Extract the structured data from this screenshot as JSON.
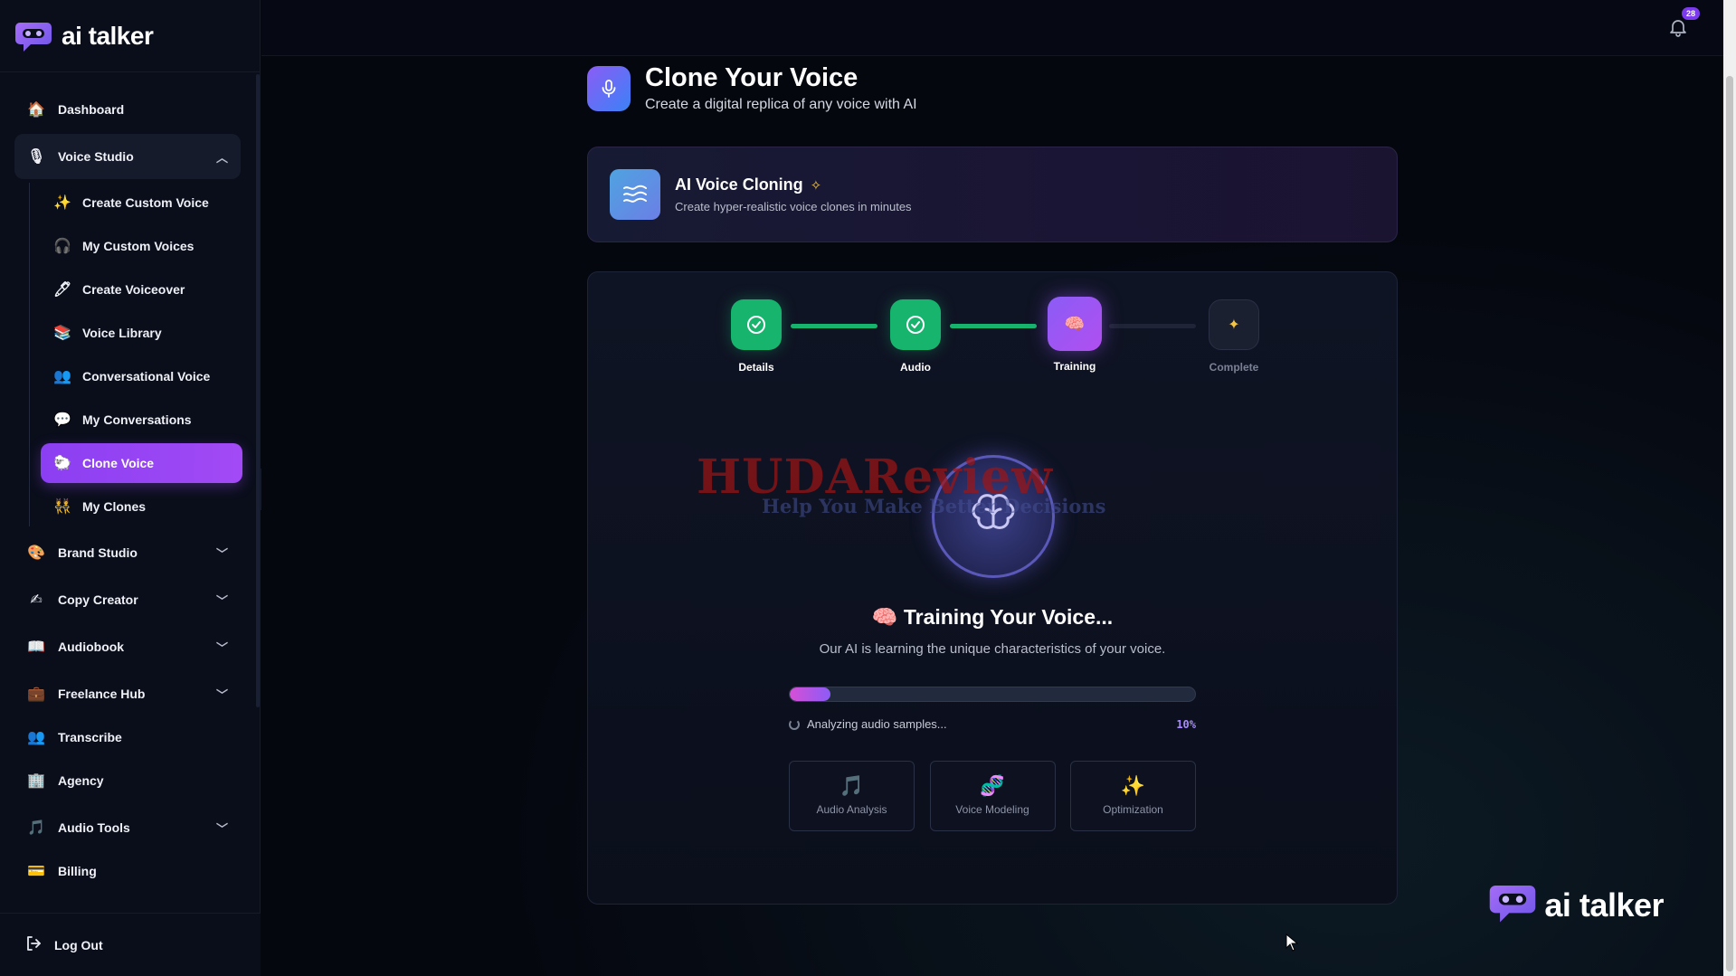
{
  "brand": {
    "name": "ai talker"
  },
  "sidebar": {
    "items": [
      {
        "label": "Dashboard",
        "icon": "house-icon"
      },
      {
        "label": "Voice Studio",
        "icon": "microphone-icon",
        "expanded": true,
        "children": [
          {
            "label": "Create Custom Voice",
            "icon": "sparkle-icon"
          },
          {
            "label": "My Custom Voices",
            "icon": "headphones-icon"
          },
          {
            "label": "Create Voiceover",
            "icon": "pen-icon"
          },
          {
            "label": "Voice Library",
            "icon": "books-icon"
          },
          {
            "label": "Conversational Voice",
            "icon": "people-icon"
          },
          {
            "label": "My Conversations",
            "icon": "speech-bubble-icon"
          },
          {
            "label": "Clone Voice",
            "icon": "sheep-icon",
            "active": true
          },
          {
            "label": "My Clones",
            "icon": "twins-icon"
          }
        ]
      },
      {
        "label": "Brand Studio",
        "icon": "palette-icon"
      },
      {
        "label": "Copy Creator",
        "icon": "writing-hand-icon"
      },
      {
        "label": "Audiobook",
        "icon": "open-book-icon"
      },
      {
        "label": "Freelance Hub",
        "icon": "briefcase-icon"
      },
      {
        "label": "Transcribe",
        "icon": "people-icon"
      },
      {
        "label": "Agency",
        "icon": "building-icon"
      },
      {
        "label": "Audio Tools",
        "icon": "music-note-icon"
      },
      {
        "label": "Billing",
        "icon": "credit-card-icon"
      }
    ],
    "logout": "Log Out"
  },
  "topbar": {
    "notifications_count": "28"
  },
  "page": {
    "title": "Clone Your Voice",
    "subtitle": "Create a digital replica of any voice with AI"
  },
  "banner": {
    "title": "AI Voice Cloning",
    "subtitle": "Create hyper-realistic voice clones in minutes"
  },
  "steps": [
    {
      "label": "Details",
      "state": "done"
    },
    {
      "label": "Audio",
      "state": "done"
    },
    {
      "label": "Training",
      "state": "current"
    },
    {
      "label": "Complete",
      "state": "todo"
    }
  ],
  "watermark": {
    "line1": "HUDAReview",
    "line2": "Help You Make Better Decisions"
  },
  "training": {
    "title": "Training Your Voice...",
    "emoji": "🧠",
    "subtitle": "Our AI is learning the unique characteristics of your voice.",
    "status": "Analyzing audio samples...",
    "progress_percent": 10,
    "progress_label": "10%"
  },
  "features": [
    {
      "label": "Audio Analysis",
      "icon": "music-note-icon",
      "glyph": "🎵"
    },
    {
      "label": "Voice Modeling",
      "icon": "dna-icon",
      "glyph": "🧬"
    },
    {
      "label": "Optimization",
      "icon": "sparkles-icon",
      "glyph": "✨"
    }
  ],
  "colors": {
    "accent": "#8b5cf6",
    "success": "#17b46e",
    "background": "#05070f"
  }
}
